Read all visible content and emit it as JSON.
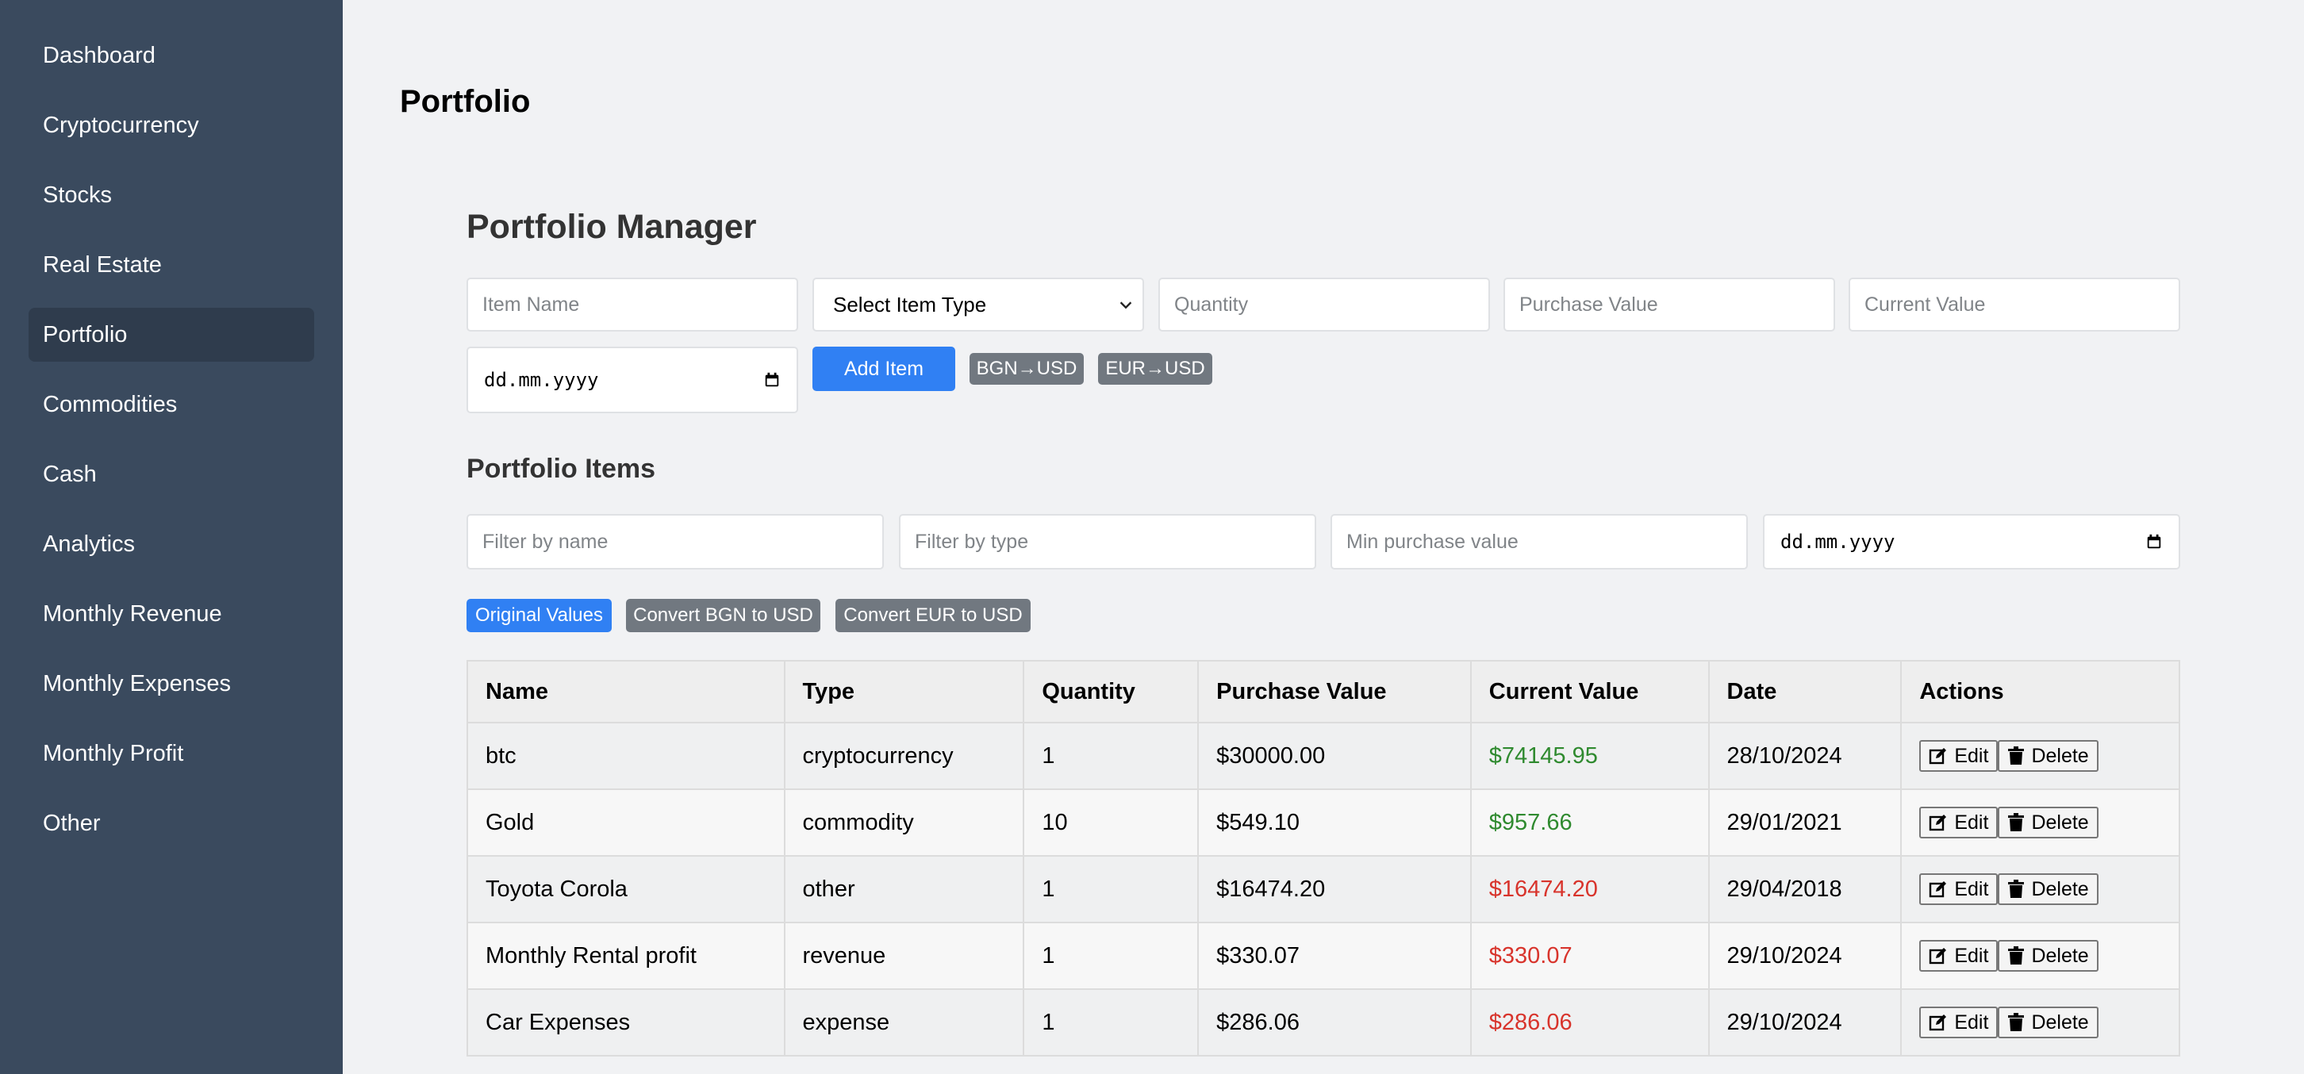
{
  "sidebar": {
    "items": [
      {
        "label": "Dashboard"
      },
      {
        "label": "Cryptocurrency"
      },
      {
        "label": "Stocks"
      },
      {
        "label": "Real Estate"
      },
      {
        "label": "Portfolio",
        "active": true
      },
      {
        "label": "Commodities"
      },
      {
        "label": "Cash"
      },
      {
        "label": "Analytics"
      },
      {
        "label": "Monthly Revenue"
      },
      {
        "label": "Monthly Expenses"
      },
      {
        "label": "Monthly Profit"
      },
      {
        "label": "Other"
      }
    ]
  },
  "page": {
    "title": "Portfolio"
  },
  "manager": {
    "title": "Portfolio Manager",
    "item_name_placeholder": "Item Name",
    "item_type_selected": "Select Item Type",
    "quantity_placeholder": "Quantity",
    "purchase_value_placeholder": "Purchase Value",
    "current_value_placeholder": "Current Value",
    "date_value": "dd.mm.yyyy",
    "add_item_label": "Add Item",
    "bgn_usd_label": "BGN→USD",
    "eur_usd_label": "EUR→USD"
  },
  "items": {
    "title": "Portfolio Items",
    "filter_name_placeholder": "Filter by name",
    "filter_type_placeholder": "Filter by type",
    "min_purchase_placeholder": "Min purchase value",
    "filter_date_value": "dd.mm.yyyy",
    "original_values_label": "Original Values",
    "convert_bgn_label": "Convert BGN to USD",
    "convert_eur_label": "Convert EUR to USD"
  },
  "table": {
    "headers": [
      "Name",
      "Type",
      "Quantity",
      "Purchase Value",
      "Current Value",
      "Date",
      "Actions"
    ],
    "edit_label": "Edit",
    "delete_label": "Delete",
    "rows": [
      {
        "name": "btc",
        "type": "cryptocurrency",
        "quantity": "1",
        "purchase": "$30000.00",
        "current": "$74145.95",
        "status": "gain",
        "date": "28/10/2024"
      },
      {
        "name": "Gold",
        "type": "commodity",
        "quantity": "10",
        "purchase": "$549.10",
        "current": "$957.66",
        "status": "gain",
        "date": "29/01/2021"
      },
      {
        "name": "Toyota Corola",
        "type": "other",
        "quantity": "1",
        "purchase": "$16474.20",
        "current": "$16474.20",
        "status": "loss",
        "date": "29/04/2018"
      },
      {
        "name": "Monthly Rental profit",
        "type": "revenue",
        "quantity": "1",
        "purchase": "$330.07",
        "current": "$330.07",
        "status": "loss",
        "date": "29/10/2024"
      },
      {
        "name": "Car Expenses",
        "type": "expense",
        "quantity": "1",
        "purchase": "$286.06",
        "current": "$286.06",
        "status": "loss",
        "date": "29/10/2024"
      }
    ]
  },
  "colors": {
    "sidebar_bg": "#3a4a5e",
    "sidebar_active": "#2f3c4d",
    "primary": "#3080f3",
    "secondary": "#717880",
    "gain": "#2f8a2f",
    "loss": "#d8342c"
  },
  "icons": {
    "edit": "edit-icon",
    "delete": "trash-icon",
    "calendar": "calendar-icon",
    "dropdown": "chevron-down-icon"
  }
}
